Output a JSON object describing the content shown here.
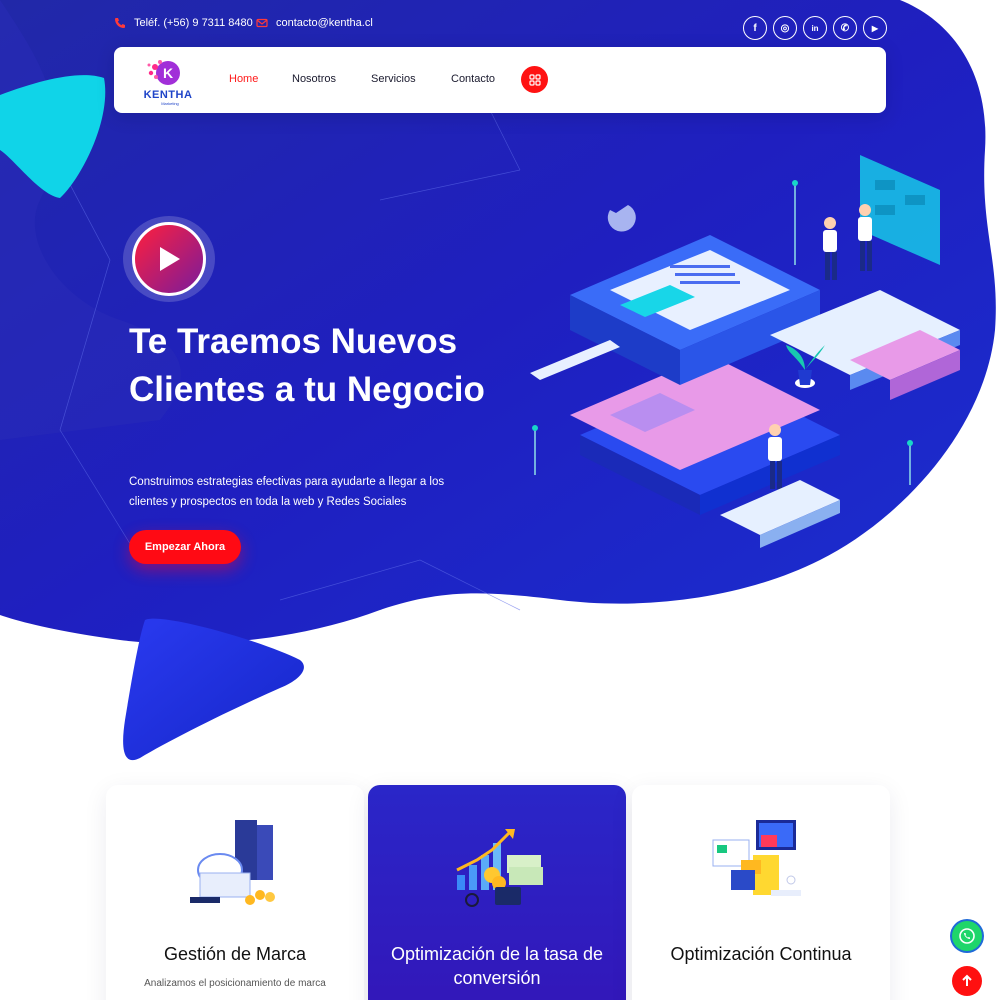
{
  "topbar": {
    "phone": "Teléf. (+56) 9 7311 8480",
    "email": "contacto@kentha.cl",
    "socials": [
      {
        "icon": "facebook-icon",
        "glyph": "f"
      },
      {
        "icon": "instagram-icon",
        "glyph": "◎"
      },
      {
        "icon": "linkedin-icon",
        "glyph": "in"
      },
      {
        "icon": "whatsapp-icon",
        "glyph": "✆"
      },
      {
        "icon": "youtube-icon",
        "glyph": "▶"
      }
    ]
  },
  "nav": {
    "logo_text": "KENTHA",
    "logo_subtext": "Marketing",
    "links": [
      "Home",
      "Nosotros",
      "Servicios",
      "Contacto"
    ],
    "active": "Home"
  },
  "hero": {
    "title": "Te Traemos Nuevos Clientes a tu Negocio",
    "subtitle": "Construimos estrategias efectivas para ayudarte a llegar a los clientes y prospectos en toda la web y Redes Sociales",
    "cta": "Empezar Ahora"
  },
  "services": [
    {
      "title": "Gestión de Marca",
      "text": "Analizamos el posicionamiento de marca",
      "icon": "brand-documents-icon"
    },
    {
      "title": "Optimización de la tasa de conversión",
      "text": "",
      "icon": "growth-chart-icon"
    },
    {
      "title": "Optimización Continua",
      "text": "",
      "icon": "tax-monitor-icon"
    }
  ],
  "colors": {
    "primary_blue": "#1f27c9",
    "accent_red": "#ff0a14",
    "cyan": "#10d4e8"
  }
}
